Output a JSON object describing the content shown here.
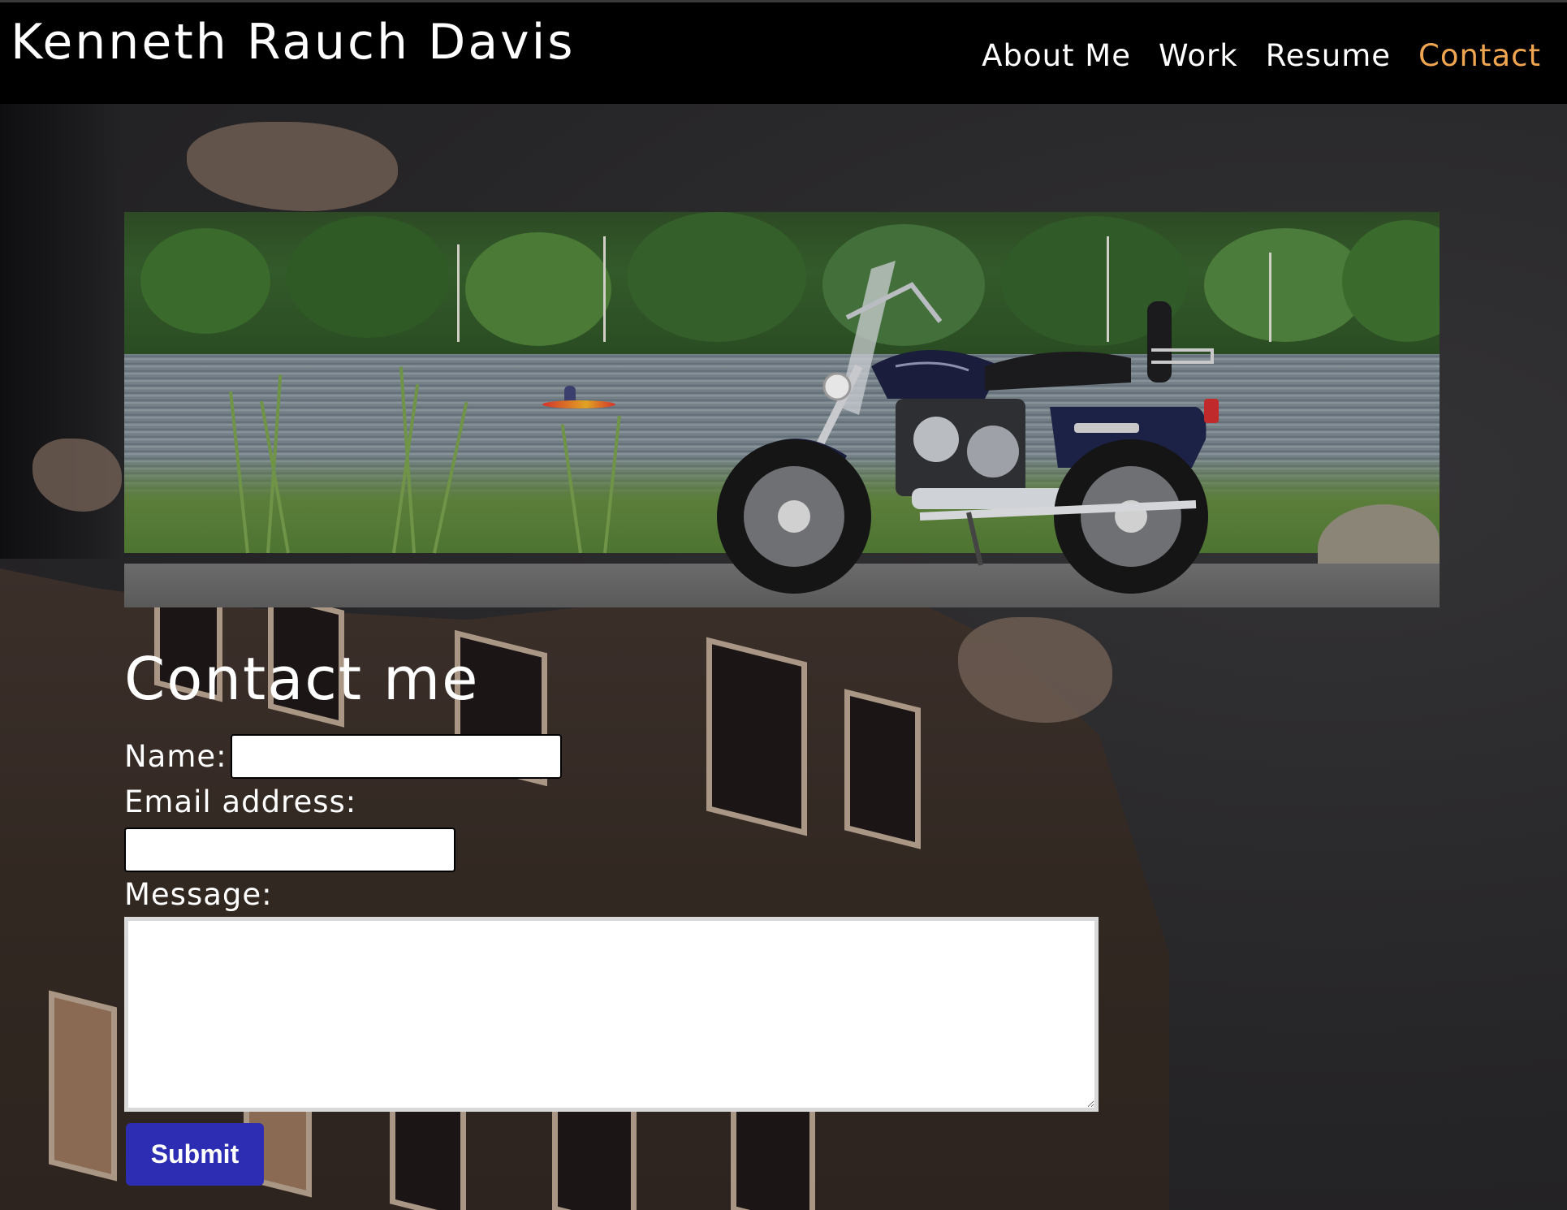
{
  "header": {
    "title": "Kenneth Rauch Davis",
    "nav": [
      {
        "label": "About Me",
        "active": false
      },
      {
        "label": "Work",
        "active": false
      },
      {
        "label": "Resume",
        "active": false
      },
      {
        "label": "Contact",
        "active": true
      }
    ]
  },
  "hero": {
    "image_subject": "motorcycle parked by a lake with a kayaker and trees"
  },
  "contact": {
    "heading": "Contact me",
    "name_label": "Name:",
    "name_value": "",
    "email_label": "Email address:",
    "email_value": "",
    "message_label": "Message:",
    "message_value": "",
    "submit_label": "Submit"
  },
  "colors": {
    "header_bg": "#000000",
    "nav_active": "#f0a650",
    "submit_bg": "#2d2db4",
    "text": "#ffffff"
  }
}
